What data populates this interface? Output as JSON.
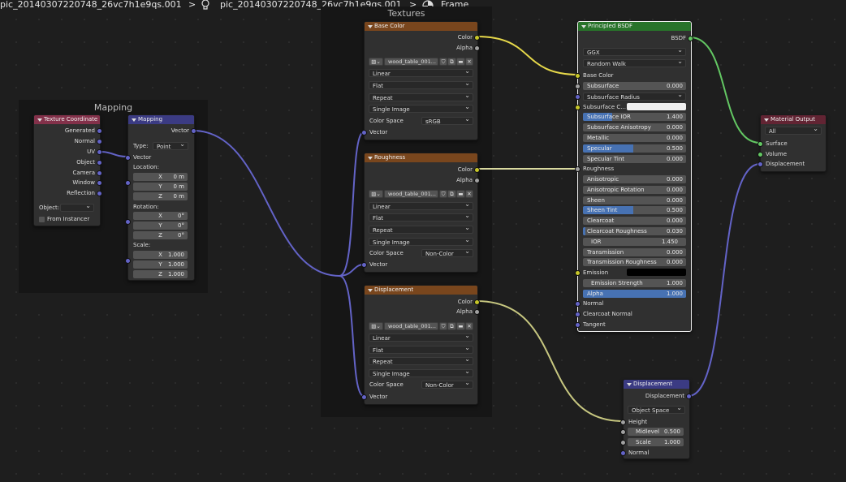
{
  "breadcrumb": {
    "object": "pic_20140307220748_26vc7h1e9qs.001",
    "material": "pic_20140307220748_26vc7h1e9qs.001",
    "node_tree": "Frame",
    "separator": ">"
  },
  "frames": {
    "mapping": "Mapping",
    "textures": "Textures"
  },
  "texture_coordinate": {
    "title": "Texture Coordinate",
    "outputs": [
      "Generated",
      "Normal",
      "UV",
      "Object",
      "Camera",
      "Window",
      "Reflection"
    ],
    "object_label": "Object:",
    "from_instancer": "From Instancer"
  },
  "mapping": {
    "title": "Mapping",
    "output": "Vector",
    "type_label": "Type:",
    "type_value": "Point",
    "input": "Vector",
    "location": "Location:",
    "rotation": "Rotation:",
    "scale": "Scale:",
    "loc": [
      {
        "k": "X",
        "v": "0 m"
      },
      {
        "k": "Y",
        "v": "0 m"
      },
      {
        "k": "Z",
        "v": "0 m"
      }
    ],
    "rot": [
      {
        "k": "X",
        "v": "0°"
      },
      {
        "k": "Y",
        "v": "0°"
      },
      {
        "k": "Z",
        "v": "0°"
      }
    ],
    "scl": [
      {
        "k": "X",
        "v": "1.000"
      },
      {
        "k": "Y",
        "v": "1.000"
      },
      {
        "k": "Z",
        "v": "1.000"
      }
    ]
  },
  "tex_base": {
    "title": "Base Color",
    "out_color": "Color",
    "out_alpha": "Alpha",
    "image": "wood_table_001...",
    "interp": "Linear",
    "proj": "Flat",
    "ext": "Repeat",
    "source": "Single Image",
    "cs_label": "Color Space",
    "cs_value": "sRGB",
    "in_vector": "Vector"
  },
  "tex_rough": {
    "title": "Roughness",
    "out_color": "Color",
    "out_alpha": "Alpha",
    "image": "wood_table_001...",
    "interp": "Linear",
    "proj": "Flat",
    "ext": "Repeat",
    "source": "Single Image",
    "cs_label": "Color Space",
    "cs_value": "Non-Color",
    "in_vector": "Vector"
  },
  "tex_disp": {
    "title": "Displacement",
    "out_color": "Color",
    "out_alpha": "Alpha",
    "image": "wood_table_001...",
    "interp": "Linear",
    "proj": "Flat",
    "ext": "Repeat",
    "source": "Single Image",
    "cs_label": "Color Space",
    "cs_value": "Non-Color",
    "in_vector": "Vector"
  },
  "bsdf": {
    "title": "Principled BSDF",
    "output": "BSDF",
    "distribution": "GGX",
    "sss_method": "Random Walk",
    "base_color": "Base Color",
    "subsurface": {
      "label": "Subsurface",
      "value": "0.000"
    },
    "subsurface_radius": "Subsurface Radius",
    "subsurface_color": "Subsurface C...",
    "subsurface_ior": {
      "label": "Subsurface IOR",
      "value": "1.400",
      "fill": 0.28
    },
    "subsurface_aniso": {
      "label": "Subsurface Anisotropy",
      "value": "0.000"
    },
    "metallic": {
      "label": "Metallic",
      "value": "0.000"
    },
    "specular": {
      "label": "Specular",
      "value": "0.500",
      "fill": 0.5
    },
    "specular_tint": {
      "label": "Specular Tint",
      "value": "0.000"
    },
    "roughness": "Roughness",
    "anisotropic": {
      "label": "Anisotropic",
      "value": "0.000"
    },
    "aniso_rotation": {
      "label": "Anisotropic Rotation",
      "value": "0.000"
    },
    "sheen": {
      "label": "Sheen",
      "value": "0.000"
    },
    "sheen_tint": {
      "label": "Sheen Tint",
      "value": "0.500",
      "fill": 0.5
    },
    "clearcoat": {
      "label": "Clearcoat",
      "value": "0.000"
    },
    "clearcoat_rough": {
      "label": "Clearcoat Roughness",
      "value": "0.030",
      "fill": 0.03
    },
    "ior": {
      "label": "IOR",
      "value": "1.450"
    },
    "transmission": {
      "label": "Transmission",
      "value": "0.000"
    },
    "transmission_rough": {
      "label": "Transmission Roughness",
      "value": "0.000"
    },
    "emission": "Emission",
    "emission_strength": {
      "label": "Emission Strength",
      "value": "1.000"
    },
    "alpha": {
      "label": "Alpha",
      "value": "1.000",
      "fill": 1.0
    },
    "normal": "Normal",
    "clearcoat_normal": "Clearcoat Normal",
    "tangent": "Tangent"
  },
  "material_output": {
    "title": "Material Output",
    "target": "All",
    "surface": "Surface",
    "volume": "Volume",
    "displacement": "Displacement"
  },
  "displacement": {
    "title": "Displacement",
    "output": "Displacement",
    "space": "Object Space",
    "height": "Height",
    "midlevel": {
      "label": "Midlevel",
      "value": "0.500"
    },
    "scale": {
      "label": "Scale",
      "value": "1.000"
    },
    "normal": "Normal"
  },
  "colors": {
    "header_input": "#83314a",
    "header_vector": "#3b3b83",
    "header_texture": "#79461d",
    "header_shader": "#28732a",
    "header_output": "#622433"
  }
}
